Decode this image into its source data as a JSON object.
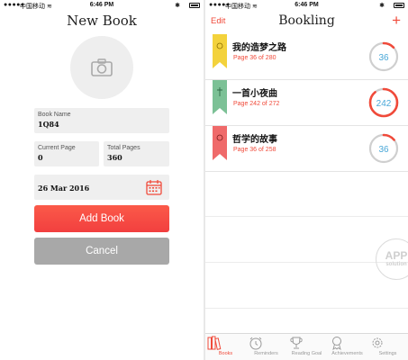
{
  "status_left": {
    "dots": "●●●●●",
    "carrier": "中国移动 ≋",
    "time": "6:46 PM",
    "bt": "✱",
    "battery": "🔋"
  },
  "status_right": {
    "dots": "●●●●●",
    "carrier": "中国移动 ≋",
    "time": "6:46 PM",
    "bt": "✱",
    "battery": "🔋"
  },
  "new_book": {
    "title": "New Book",
    "name_label": "Book Name",
    "name_value": "1Q84",
    "current_label": "Current Page",
    "current_value": "0",
    "total_label": "Total Pages",
    "total_value": "360",
    "date_value": "26 Mar 2016",
    "add_label": "Add Book",
    "cancel_label": "Cancel"
  },
  "bookling": {
    "edit": "Edit",
    "title": "Bookling",
    "plus": "+",
    "books": [
      {
        "title": "我的造梦之路",
        "page_text": "Page 36 of 280",
        "ring_value": "36",
        "progress": 0.13,
        "ribbon_color": "#f3d23c"
      },
      {
        "title": "一首小夜曲",
        "page_text": "Page 242 of 272",
        "ring_value": "242",
        "progress": 0.89,
        "ribbon_color": "#7cc196"
      },
      {
        "title": "哲学的故事",
        "page_text": "Page 36 of 258",
        "ring_value": "36",
        "progress": 0.14,
        "ribbon_color": "#ef6a6a"
      }
    ],
    "watermark": {
      "a": "APP",
      "b": "solution"
    },
    "tabs": [
      "Books",
      "Reminders",
      "Reading Goal",
      "Achievements",
      "Settings"
    ],
    "colors": {
      "accent": "#f04a3a",
      "ring_text": "#4aa8d8",
      "ring_track": "#cfcfcf"
    }
  }
}
